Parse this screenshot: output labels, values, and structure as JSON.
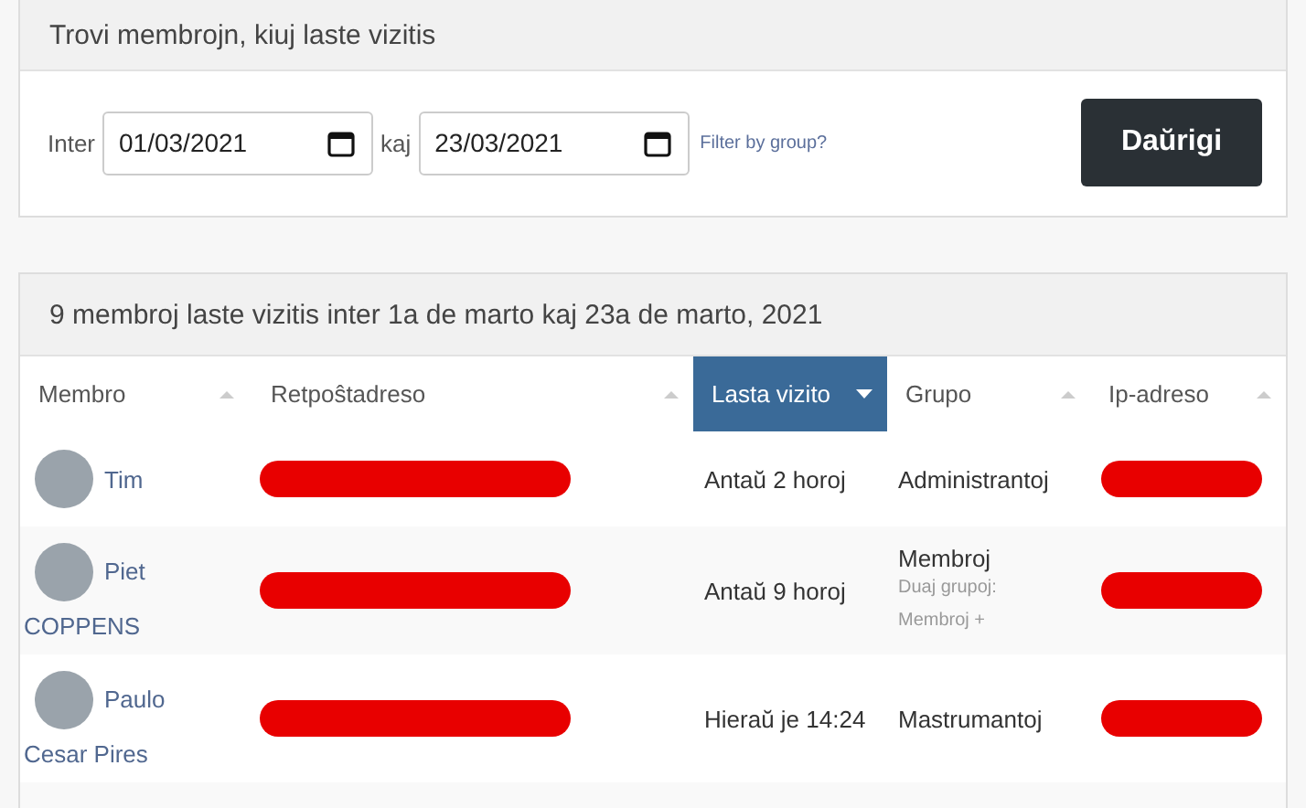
{
  "search_panel": {
    "title": "Trovi membrojn, kiuj laste vizitis",
    "from_label": "Inter",
    "from_date": "01/03/2021",
    "to_label": "kaj",
    "to_date": "23/03/2021",
    "group_filter_link": "Filter by group?",
    "submit_button": "Daŭrigi"
  },
  "results_panel": {
    "title": "9 membroj laste vizitis inter 1a de marto kaj 23a de marto, 2021",
    "columns": [
      {
        "label": "Membro",
        "selected": false
      },
      {
        "label": "Retpoŝtadreso",
        "selected": false
      },
      {
        "label": "Lasta vizito",
        "selected": true
      },
      {
        "label": "Grupo",
        "selected": false
      },
      {
        "label": "Ip-adreso",
        "selected": false
      }
    ],
    "rows": [
      {
        "member_first": "Tim",
        "member_rest": "",
        "email_redacted": true,
        "last_visit": "Antaŭ 2 horoj",
        "group": "Administrantoj",
        "secondary_groups_label": "",
        "secondary_groups": "",
        "ip_redacted": true
      },
      {
        "member_first": "Piet",
        "member_rest": "COPPENS",
        "email_redacted": true,
        "last_visit": "Antaŭ 9 horoj",
        "group": "Membroj",
        "secondary_groups_label": "Duaj grupoj:",
        "secondary_groups": "Membroj +",
        "ip_redacted": true
      },
      {
        "member_first": "Paulo",
        "member_rest": "Cesar Pires",
        "email_redacted": true,
        "last_visit": "Hieraŭ je 14:24",
        "group": "Mastrumantoj",
        "secondary_groups_label": "",
        "secondary_groups": "",
        "ip_redacted": true
      }
    ]
  }
}
